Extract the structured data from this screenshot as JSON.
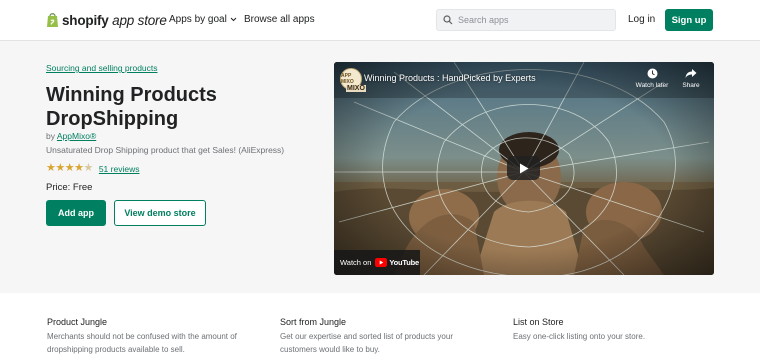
{
  "header": {
    "logo_brand": "shopify",
    "logo_suffix": "app store",
    "nav_goal": "Apps by goal",
    "nav_browse": "Browse all apps",
    "search_placeholder": "Search apps",
    "login": "Log in",
    "signup": "Sign up"
  },
  "app": {
    "breadcrumb": "Sourcing and selling products",
    "title": "Winning Products DropShipping",
    "by_prefix": "by",
    "developer": "AppMixo®",
    "tagline": "Unsaturated Drop Shipping product that get Sales! (AliExpress)",
    "rating": 4.5,
    "reviews": "51 reviews",
    "price": "Price: Free",
    "add_app": "Add app",
    "demo": "View demo store"
  },
  "video": {
    "channel_logo_text": "APP MIXO",
    "channel_tag": "MIXO",
    "title": "Winning Products : HandPicked by Experts",
    "watch_later": "Watch later",
    "share": "Share",
    "watch_on": "Watch on",
    "youtube": "YouTube"
  },
  "features": [
    {
      "title": "Product Jungle",
      "desc": "Merchants should not be confused with the amount of dropshipping products available to sell."
    },
    {
      "title": "Sort from Jungle",
      "desc": "Get our expertise and sorted list of products your customers would like to buy."
    },
    {
      "title": "List on Store",
      "desc": "Easy one-click listing onto your store."
    }
  ],
  "colors": {
    "accent": "#008060",
    "link": "#007f5f",
    "star": "#d8a531",
    "hero_bg": "#f6f6f7"
  }
}
